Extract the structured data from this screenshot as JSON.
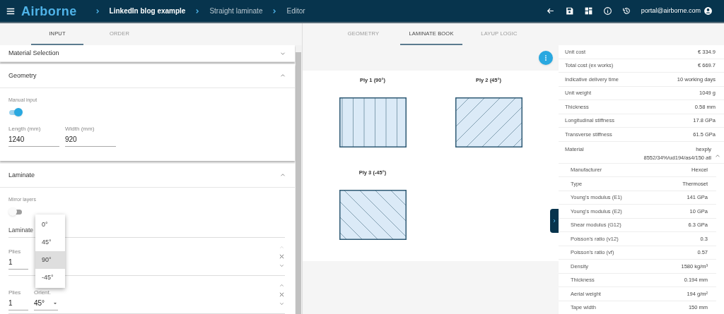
{
  "header": {
    "logo": "Airborne",
    "breadcrumb": [
      "LinkedIn blog example",
      "Straight laminate",
      "Editor"
    ],
    "user": "portal@airborne.com"
  },
  "left_tabs": [
    {
      "label": "INPUT",
      "selected": true
    },
    {
      "label": "ORDER",
      "selected": false
    }
  ],
  "material_section": {
    "title": "Material Selection",
    "expanded": false
  },
  "geometry": {
    "title": "Geometry",
    "expanded": true,
    "manual_input": {
      "label": "Manual input",
      "on": true
    },
    "fields": [
      {
        "label": "Length (mm)",
        "value": "1240"
      },
      {
        "label": "Width (mm)",
        "value": "920"
      }
    ]
  },
  "laminate": {
    "title": "Laminate",
    "expanded": true,
    "mirror": {
      "label": "Mirror layers",
      "on": false
    },
    "subtitle": "Laminate",
    "rows": [
      {
        "plies_label": "Plies",
        "plies_value": "1"
      },
      {
        "plies_label": "Plies",
        "plies_value": "1",
        "orient_label": "Orient.",
        "orient_value": "45°"
      }
    ]
  },
  "dropdown": {
    "options": [
      {
        "label": "0°",
        "selected": false
      },
      {
        "label": "45°",
        "selected": false
      },
      {
        "label": "90°",
        "selected": true
      },
      {
        "label": "-45°",
        "selected": false
      }
    ]
  },
  "center_tabs": [
    {
      "label": "GEOMETRY",
      "selected": false
    },
    {
      "label": "LAMINATE BOOK",
      "selected": true
    },
    {
      "label": "LAYUP LOGIC",
      "selected": false
    }
  ],
  "plies": [
    {
      "label": "Ply 1 (90°)",
      "kind": "vertical"
    },
    {
      "label": "Ply 2 (45°)",
      "kind": "rising"
    },
    {
      "label": "Ply 3 (-45°)",
      "kind": "falling"
    }
  ],
  "properties": [
    {
      "label": "Unit cost",
      "value": "€ 334.9"
    },
    {
      "label": "Total cost (ex works)",
      "value": "€ 669.7"
    },
    {
      "label": "Indicative delivery time",
      "value": "10 working days"
    },
    {
      "label": "Unit weight",
      "value": "1049 g"
    },
    {
      "label": "Thickness",
      "value": "0.58 mm"
    },
    {
      "label": "Longitudinal stiffness",
      "value": "17.8 GPa"
    },
    {
      "label": "Transverse stiffness",
      "value": "61.5 GPa"
    }
  ],
  "material": {
    "label": "Material",
    "value": "hexply 8552/34%/ud194/as4/150 atl",
    "expanded": true,
    "children": [
      {
        "label": "Manufacturer",
        "value": "Hexcel"
      },
      {
        "label": "Type",
        "value": "Thermoset"
      },
      {
        "label": "Young's modulus (E1)",
        "value": "141 GPa"
      },
      {
        "label": "Young's modulus (E2)",
        "value": "10 GPa"
      },
      {
        "label": "Shear modulus (G12)",
        "value": "6.3 GPa"
      },
      {
        "label": "Poisson's ratio (v12)",
        "value": "0.3"
      },
      {
        "label": "Poisson's ratio (vf)",
        "value": "0.57"
      },
      {
        "label": "Density",
        "value": "1580 kg/m³"
      },
      {
        "label": "Thickness",
        "value": "0.194 mm"
      },
      {
        "label": "Aerial weight",
        "value": "194 g/m²"
      },
      {
        "label": "Tape width",
        "value": "150 mm"
      }
    ]
  }
}
